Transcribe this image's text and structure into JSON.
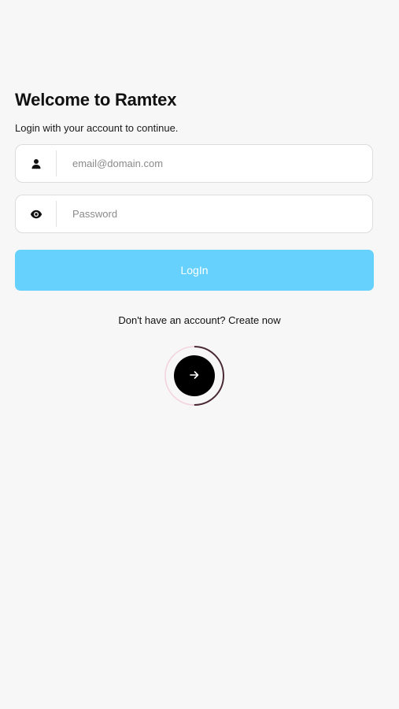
{
  "login": {
    "title": "Welcome to Ramtex",
    "subtitle": "Login with your account to continue.",
    "email_field": {
      "value": "",
      "placeholder": "email@domain.com",
      "icon": "user-icon"
    },
    "password_field": {
      "value": "",
      "placeholder": "Password",
      "icon": "eye-icon"
    },
    "login_button": {
      "label": "LogIn",
      "color": "#66d1fd"
    },
    "signup_prompt": "Don't have an account?",
    "signup_link": "Create now",
    "next_button": {
      "icon": "arrow-right-icon",
      "progress_fraction": 0.5,
      "ring_color": "#4a2a33",
      "track_color": "#f4d4dc"
    }
  }
}
